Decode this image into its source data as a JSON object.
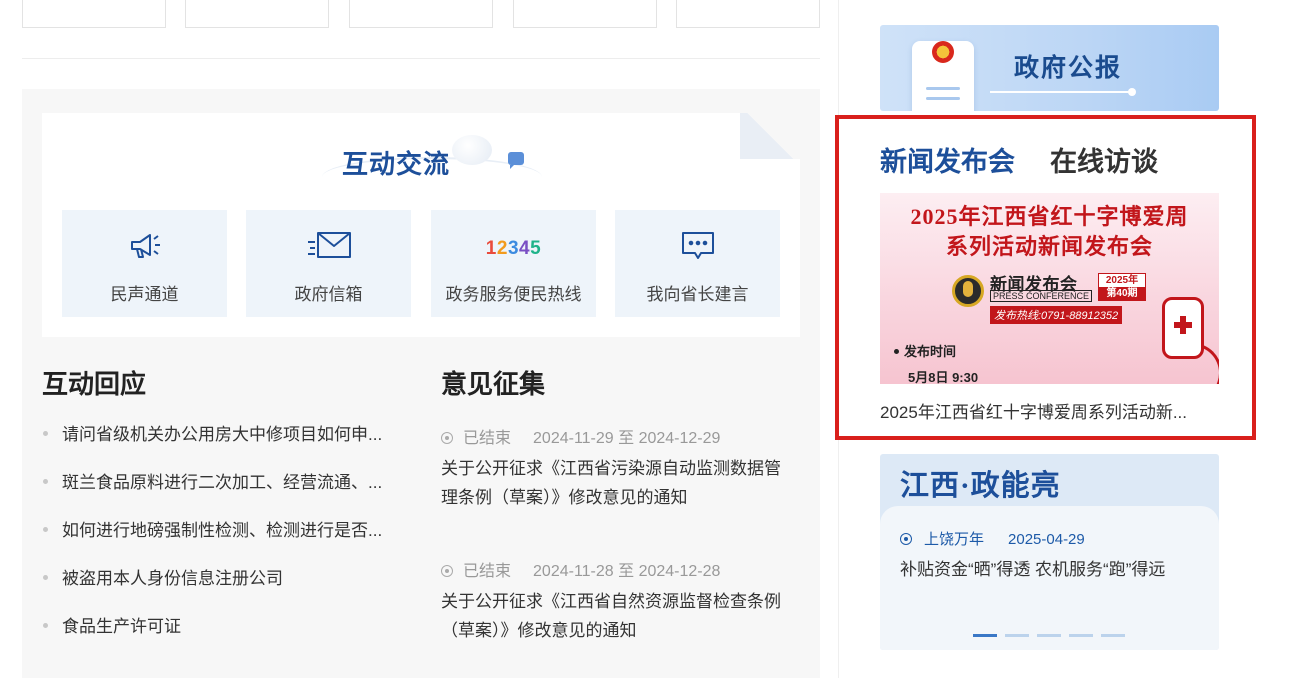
{
  "colors": {
    "brand_blue": "#1d4f9a",
    "highlight_red": "#d9201c",
    "panel_gray": "#f7f7f7",
    "service_tile": "#eef4fa",
    "hotline_blue": "#1d5aa8"
  },
  "interaction": {
    "title": "互动交流",
    "title_icon": "chat-bubble-icon",
    "services": [
      {
        "label": "民声通道",
        "icon": "megaphone-icon"
      },
      {
        "label": "政府信箱",
        "icon": "mail-icon"
      },
      {
        "label": "政务服务便民热线",
        "icon": "hotline-12345-icon",
        "icon_text": [
          "1",
          "2",
          "3",
          "4",
          "5"
        ]
      },
      {
        "label": "我向省长建言",
        "icon": "message-dots-icon"
      }
    ]
  },
  "responses": {
    "title": "互动回应",
    "items": [
      "请问省级机关办公用房大中修项目如何申...",
      "斑兰食品原料进行二次加工、经营流通、...",
      "如何进行地磅强制性检测、检测进行是否...",
      "被盗用本人身份信息注册公司",
      "食品生产许可证"
    ]
  },
  "opinions": {
    "title": "意见征集",
    "items": [
      {
        "status": "已结束",
        "date_range": "2024-11-29 至 2024-12-29",
        "text": "关于公开征求《江西省污染源自动监测数据管理条例（草案）》修改意见的通知"
      },
      {
        "status": "已结束",
        "date_range": "2024-11-28 至 2024-12-28",
        "text": "关于公开征求《江西省自然资源监督检查条例（草案）》修改意见的通知"
      }
    ]
  },
  "gazette": {
    "title": "政府公报"
  },
  "news": {
    "tabs": [
      {
        "label": "新闻发布会",
        "active": true
      },
      {
        "label": "在线访谈",
        "active": false
      }
    ],
    "banner": {
      "line1": "2025年江西省红十字博爱周",
      "line2": "系列活动新闻发布会",
      "press_cn": "新闻发布会",
      "press_en": "PRESS CONFERENCE",
      "year": "2025年",
      "issue": "第40期",
      "hotline": "发布热线:0791-88912352",
      "time_label": "发布时间",
      "time_value": "5月8日 9:30"
    },
    "caption": "2025年江西省红十字博爱周系列活动新..."
  },
  "jx": {
    "title": "江西·政能亮",
    "source": "上饶万年",
    "date": "2025-04-29",
    "text": "补贴资金“晒”得透 农机服务“跑”得远",
    "pages": 5,
    "current_page": 1
  }
}
